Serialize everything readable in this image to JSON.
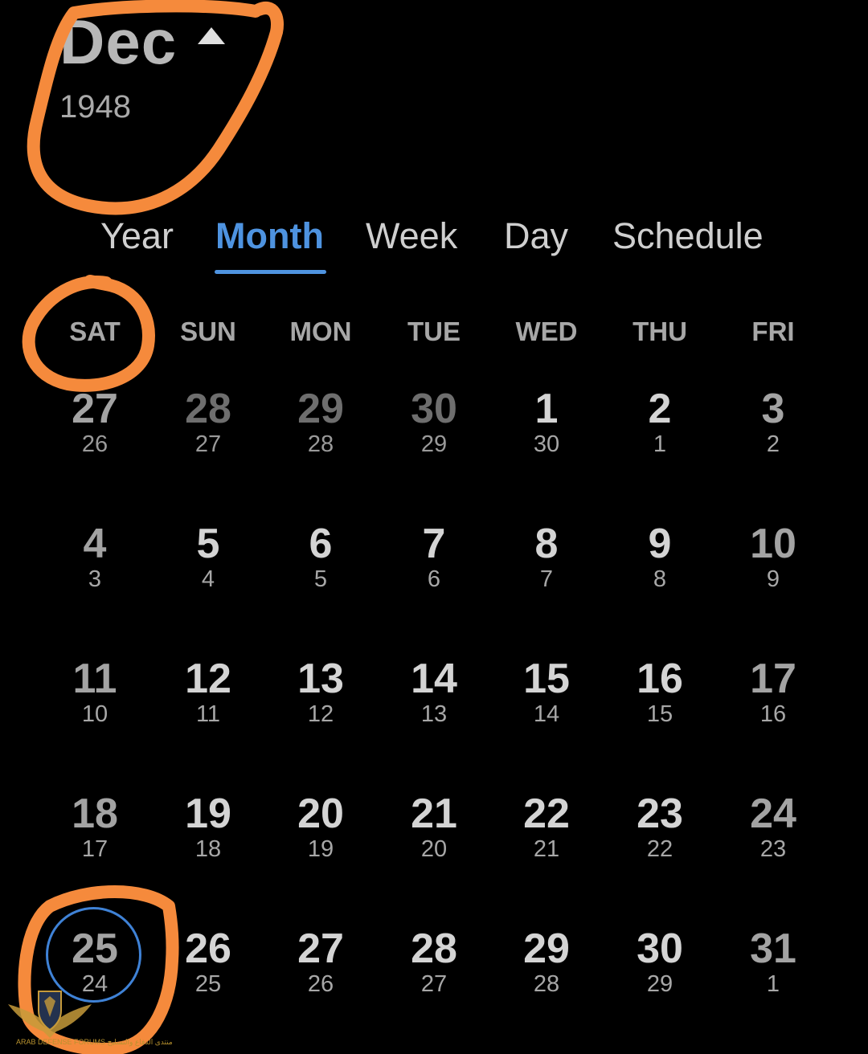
{
  "header": {
    "month": "Dec",
    "year": "1948"
  },
  "tabs": [
    "Year",
    "Month",
    "Week",
    "Day",
    "Schedule"
  ],
  "active_tab": "Month",
  "weekdays": [
    "SAT",
    "SUN",
    "MON",
    "TUE",
    "WED",
    "THU",
    "FRI"
  ],
  "weeks": [
    [
      {
        "g": "27",
        "h": "26",
        "muted": true
      },
      {
        "g": "28",
        "h": "27",
        "muted": true
      },
      {
        "g": "29",
        "h": "28",
        "muted": true
      },
      {
        "g": "30",
        "h": "29",
        "muted": true
      },
      {
        "g": "1",
        "h": "30"
      },
      {
        "g": "2",
        "h": "1"
      },
      {
        "g": "3",
        "h": "2"
      }
    ],
    [
      {
        "g": "4",
        "h": "3"
      },
      {
        "g": "5",
        "h": "4"
      },
      {
        "g": "6",
        "h": "5"
      },
      {
        "g": "7",
        "h": "6"
      },
      {
        "g": "8",
        "h": "7"
      },
      {
        "g": "9",
        "h": "8"
      },
      {
        "g": "10",
        "h": "9"
      }
    ],
    [
      {
        "g": "11",
        "h": "10"
      },
      {
        "g": "12",
        "h": "11"
      },
      {
        "g": "13",
        "h": "12"
      },
      {
        "g": "14",
        "h": "13"
      },
      {
        "g": "15",
        "h": "14"
      },
      {
        "g": "16",
        "h": "15"
      },
      {
        "g": "17",
        "h": "16"
      }
    ],
    [
      {
        "g": "18",
        "h": "17"
      },
      {
        "g": "19",
        "h": "18"
      },
      {
        "g": "20",
        "h": "19"
      },
      {
        "g": "21",
        "h": "20"
      },
      {
        "g": "22",
        "h": "21"
      },
      {
        "g": "23",
        "h": "22"
      },
      {
        "g": "24",
        "h": "23"
      }
    ],
    [
      {
        "g": "25",
        "h": "24",
        "today": true
      },
      {
        "g": "26",
        "h": "25"
      },
      {
        "g": "27",
        "h": "26"
      },
      {
        "g": "28",
        "h": "27"
      },
      {
        "g": "29",
        "h": "28"
      },
      {
        "g": "30",
        "h": "29"
      },
      {
        "g": "31",
        "h": "1"
      }
    ]
  ],
  "colors": {
    "background": "#000000",
    "accent": "#4e93e0",
    "annotation": "#f58a3c",
    "text": "#d4d4d4",
    "muted_text": "#6e6e6e"
  },
  "icons": {
    "month_toggle": "triangle-up-icon",
    "watermark": "eagle-shield-logo"
  },
  "watermark": {
    "text": "ARAB DEFENSE FORUMS منتدى الدفاع والتسليح"
  }
}
